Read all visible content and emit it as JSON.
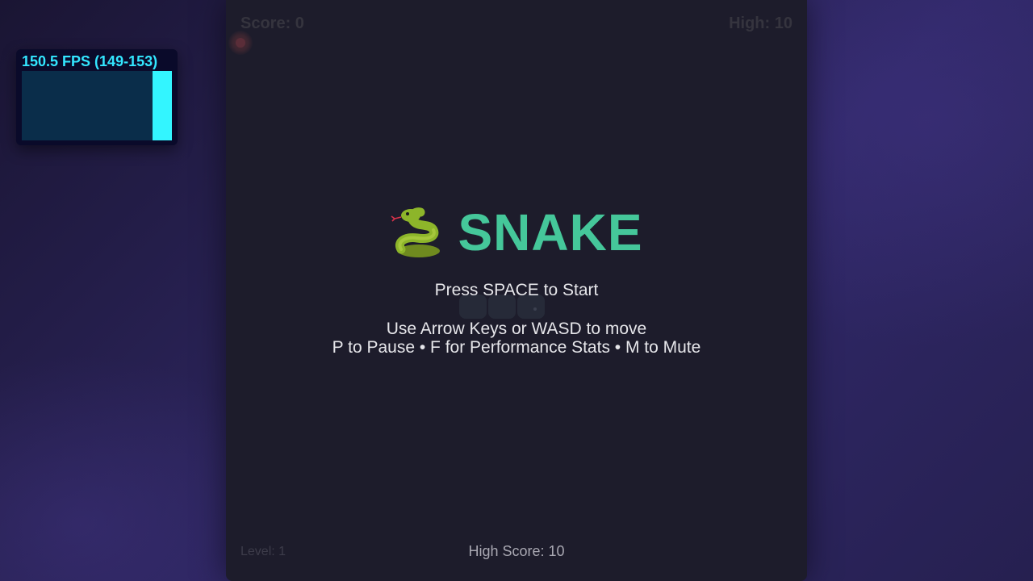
{
  "fps_monitor": {
    "label": "150.5 FPS (149-153)",
    "current_level": 1.0,
    "colors": {
      "text": "#33e6ff",
      "bar": "#33f5ff",
      "graph_bg": "#0a2d4a"
    }
  },
  "hud": {
    "score": "Score: 0",
    "high": "High: 10"
  },
  "overlay": {
    "icon": "snake-emoji-icon",
    "title": "SNAKE",
    "start_prompt": "Press SPACE to Start",
    "controls_line1": "Use Arrow Keys or WASD to move",
    "controls_line2": "P to Pause • F for Performance Stats • M to Mute"
  },
  "footer": {
    "level": "Level: 1",
    "high_score": "High Score: 10"
  },
  "colors": {
    "board_bg": "#1d1c2b",
    "title_green": "#45c79a",
    "page_bg": "#2a2358"
  }
}
